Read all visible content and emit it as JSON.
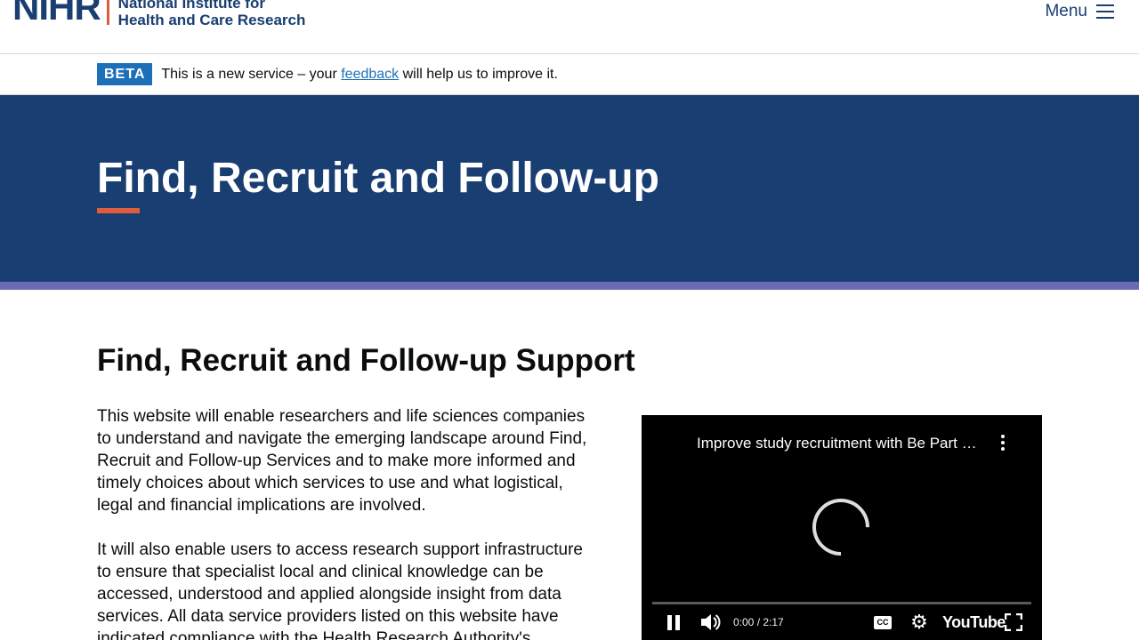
{
  "header": {
    "logo_mark": "NIHR",
    "logo_text_line1": "National Institute for",
    "logo_text_line2": "Health and Care Research",
    "menu_label": "Menu"
  },
  "beta": {
    "tag": "BETA",
    "text_before": "This is a new service – your ",
    "link": "feedback",
    "text_after": " will help us to improve it."
  },
  "hero": {
    "title": "Find, Recruit and Follow-up"
  },
  "main": {
    "heading": "Find, Recruit and Follow-up Support",
    "paragraphs": [
      "This website will enable researchers and life sciences companies to understand and navigate the emerging landscape around Find, Recruit and Follow-up Services and to make more informed and timely choices about which services to use and what logistical, legal and financial implications are involved.",
      "It will also enable users to access research support infrastructure to ensure that specialist local and clinical knowledge can be accessed, understood and applied alongside insight from data services. All data service providers listed on this website have indicated compliance with the Health Research Authority's"
    ]
  },
  "video": {
    "title": "Improve study recruitment with Be Part …",
    "time": "0:00 / 2:17",
    "cc_label": "CC",
    "brand": "YouTube"
  },
  "colors": {
    "navy": "#193e72",
    "accent_red": "#e05c3e",
    "stripe_purple": "#6b6ab4",
    "link_blue": "#1d70b8"
  },
  "icons": {
    "menu": "hamburger-icon",
    "pause": "pause-icon",
    "volume": "volume-icon",
    "settings": "gear-icon",
    "fullscreen": "fullscreen-icon",
    "more": "more-vertical-icon"
  }
}
